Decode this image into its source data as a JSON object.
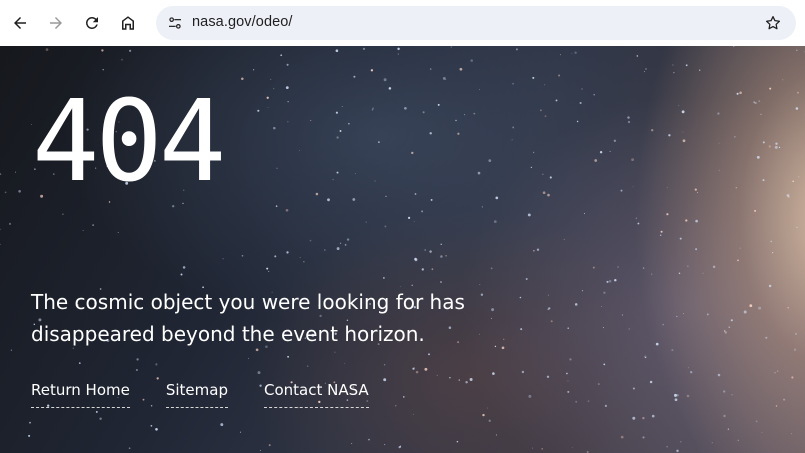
{
  "browser": {
    "url": "nasa.gov/odeo/",
    "back_icon": "arrow-left-icon",
    "forward_icon": "arrow-right-icon",
    "reload_icon": "reload-icon",
    "home_icon": "home-icon",
    "site_info_icon": "tune-icon",
    "bookmark_icon": "star-icon"
  },
  "error_page": {
    "code": "404",
    "message": "The cosmic object you were looking for has disappeared beyond the event horizon.",
    "links": [
      {
        "label": "Return Home"
      },
      {
        "label": "Sitemap"
      },
      {
        "label": "Contact NASA"
      }
    ]
  },
  "colors": {
    "text": "#ffffff",
    "omnibox_bg": "#edf0f7",
    "toolbar_bg": "#ffffff"
  }
}
